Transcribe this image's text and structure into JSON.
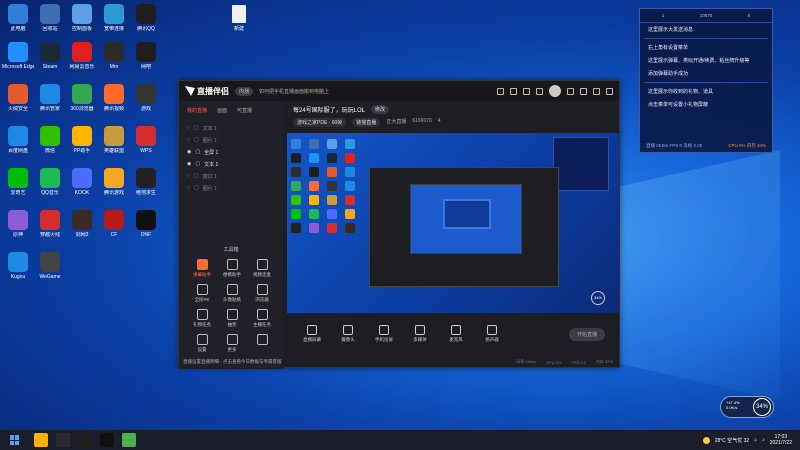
{
  "desktop": {
    "icons": [
      {
        "label": "此电脑",
        "color": "#2f7fd6"
      },
      {
        "label": "回收站",
        "color": "#3d6fb0"
      },
      {
        "label": "控制面板",
        "color": "#5aa0e6"
      },
      {
        "label": "宽带连接",
        "color": "#2a9ad8"
      },
      {
        "label": "腾讯QQ",
        "color": "#1e1e1e"
      },
      {
        "label": "Microsoft Edge",
        "color": "#1e90ff"
      },
      {
        "label": "Steam",
        "color": "#1b2838"
      },
      {
        "label": "网易云音乐",
        "color": "#e02020"
      },
      {
        "label": "Mnr",
        "color": "#2b2b2b"
      },
      {
        "label": "网吧",
        "color": "#1e1e1e"
      },
      {
        "label": "火绒安全",
        "color": "#e35b2c"
      },
      {
        "label": "腾讯管家",
        "color": "#1e88e5"
      },
      {
        "label": "360浏览器",
        "color": "#33a852"
      },
      {
        "label": "腾讯视频",
        "color": "#ff6a2a"
      },
      {
        "label": "游戏",
        "color": "#333"
      },
      {
        "label": "百度网盘",
        "color": "#1e88e5"
      },
      {
        "label": "微信",
        "color": "#2dc100"
      },
      {
        "label": "PP助手",
        "color": "#ffb400"
      },
      {
        "label": "英雄联盟",
        "color": "#c89b3c"
      },
      {
        "label": "WPS",
        "color": "#d32f2f"
      },
      {
        "label": "爱奇艺",
        "color": "#00be06"
      },
      {
        "label": "QQ音乐",
        "color": "#1db954"
      },
      {
        "label": "KOOK",
        "color": "#4b6cff"
      },
      {
        "label": "腾讯游戏",
        "color": "#f5a623"
      },
      {
        "label": "绝地求生",
        "color": "#222"
      },
      {
        "label": "原神",
        "color": "#8c5cd6"
      },
      {
        "label": "穿越火线",
        "color": "#d32f2f"
      },
      {
        "label": "剑网3",
        "color": "#3a2a20"
      },
      {
        "label": "CF",
        "color": "#b71c1c"
      },
      {
        "label": "DNF",
        "color": "#111"
      },
      {
        "label": "Kugou",
        "color": "#1e88e5"
      },
      {
        "label": "WeGame",
        "color": "#444"
      }
    ],
    "paper_icon_label": "新建"
  },
  "app": {
    "logo_text": "直播伴侣",
    "version_badge": "内测",
    "announce": "如何把手机直播画面搬到电脑上",
    "sidebar_tabs": [
      "我的直播",
      "画面",
      "可直播"
    ],
    "scenes": [
      {
        "label": "文本 1",
        "visible": false
      },
      {
        "label": "图片 1",
        "visible": false
      },
      {
        "label": "全屏 1",
        "visible": true
      },
      {
        "label": "文本 1",
        "visible": true
      },
      {
        "label": "窗口 1",
        "visible": false
      },
      {
        "label": "图片 1",
        "visible": false
      }
    ],
    "tools_title": "工具箱",
    "tools": [
      {
        "label": "弹幕助手",
        "hot": true
      },
      {
        "label": "便携助手",
        "hot": false
      },
      {
        "label": "视频连麦",
        "hot": false
      },
      {
        "label": "全民PK",
        "hot": false
      },
      {
        "label": "头像贴纸",
        "hot": false
      },
      {
        "label": "浏览器",
        "hot": false
      },
      {
        "label": "礼物任务",
        "hot": false
      },
      {
        "label": "抽奖",
        "hot": false
      },
      {
        "label": "主播任务",
        "hot": false
      },
      {
        "label": "设置",
        "hot": false
      },
      {
        "label": "更多",
        "hot": false
      },
      {
        "label": "",
        "hot": false
      }
    ],
    "sidebar_footer": "直播设置直播明细 · 点击查看今日数据与专属客服",
    "stream_title": "每24号国际服了，玩玩LOL",
    "stream_title_badge": "修改",
    "meta": [
      "游戏之家PDE · 60帧",
      "链接直播",
      "正大直播",
      "6169070",
      "4"
    ],
    "bottom_items": [
      "直播屏幕",
      "摄像头",
      "手机投屏",
      "多媒体",
      "麦克风",
      "扬声器"
    ],
    "start_button": "开始直播",
    "status_items": [
      "码率 0kbps",
      "CPU 0%",
      "FPS 0.0",
      "内存 32%"
    ]
  },
  "notice": {
    "top": [
      "1",
      "10570",
      "0"
    ],
    "lines": [
      "这里展示大发送消息",
      "右上角有设置菜单",
      "这里展示弹幕、类似开通/续费、粘丝牌升级等",
      "添加弹幕助手成功",
      "这里展示你收到的礼物、道具",
      "点击菜单可设置小礼物屏蔽"
    ],
    "foot_left": "直播 0KB/s FPS 0 丢帧 0.00",
    "foot_right": "CPU 0% 内存 34%"
  },
  "widget": {
    "small_top": "+47.4%",
    "small_bottom": "0.0K/s",
    "circle": "34%"
  },
  "taskbar": {
    "weather": "28°C 空气优 32",
    "time": "17:03",
    "date": "2021/7/22",
    "apps": [
      "#ffb300",
      "#2b2b2b",
      "#1e1e1e",
      "#111",
      "#4caf50"
    ]
  }
}
